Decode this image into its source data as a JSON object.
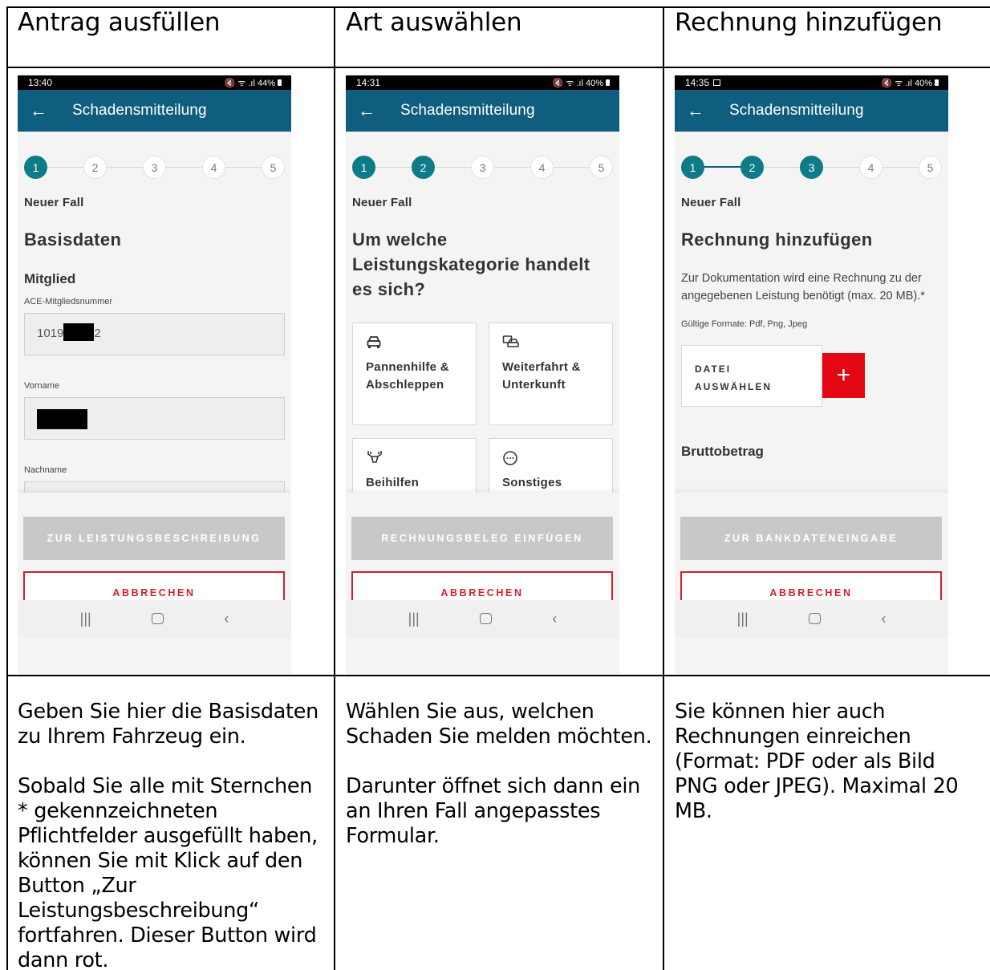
{
  "columns": [
    {
      "title": "Antrag ausfüllen",
      "description": [
        "Geben Sie hier die Basisdaten zu Ihrem Fahrzeug ein.",
        "Sobald Sie alle mit Sternchen * gekennzeichneten Pflichtfelder ausgefüllt haben, können Sie mit Klick auf den Button „Zur Leistungsbeschreibung“ fortfahren. Dieser Button wird dann rot."
      ],
      "phone": {
        "time": "13:40",
        "status_icons": "🔇 ᯤ .ıl 44%",
        "appbar_title": "Schadensmitteilung",
        "steps": [
          "1",
          "2",
          "3",
          "4",
          "5"
        ],
        "active_steps": 1,
        "case_label": "Neuer Fall",
        "heading": "Basisdaten",
        "section": "Mitglied",
        "fields": [
          {
            "label": "ACE-Mitgliedsnummer",
            "value_start": "1019",
            "value_end": "2"
          },
          {
            "label": "Vorname"
          },
          {
            "label": "Nachname"
          }
        ],
        "primary_button": "ZUR LEISTUNGSBESCHREIBUNG",
        "cancel_button": "ABBRECHEN"
      }
    },
    {
      "title": "Art auswählen",
      "description": [
        "Wählen Sie aus, welchen Schaden Sie melden möchten.",
        "Darunter öffnet sich dann ein an Ihren Fall angepasstes Formular."
      ],
      "phone": {
        "time": "14:31",
        "status_icons": "🔇 ᯤ .ıl 40%",
        "appbar_title": "Schadensmitteilung",
        "steps": [
          "1",
          "2",
          "3",
          "4",
          "5"
        ],
        "active_steps": 2,
        "case_label": "Neuer Fall",
        "heading": "Um welche Leistungskategorie handelt es sich?",
        "categories": [
          {
            "icon": "car-icon",
            "label": "Pannenhilfe & Abschleppen"
          },
          {
            "icon": "car-transfer-icon",
            "label": "Weiterfahrt & Unterkunft"
          },
          {
            "icon": "deer-icon",
            "label": "Beihilfen"
          },
          {
            "icon": "more-icon",
            "label": "Sonstiges"
          }
        ],
        "primary_button": "RECHNUNGSBELEG EINFÜGEN",
        "cancel_button": "ABBRECHEN"
      }
    },
    {
      "title": "Rechnung hinzufügen",
      "description": [
        "Sie können hier auch Rechnungen einreichen (Format: PDF oder als Bild PNG oder JPEG). Maximal 20 MB."
      ],
      "phone": {
        "time": "14:35",
        "status_icons": "🔇 ᯤ .ıl 40%",
        "appbar_title": "Schadensmitteilung",
        "steps": [
          "1",
          "2",
          "3",
          "4",
          "5"
        ],
        "active_steps": 3,
        "case_label": "Neuer Fall",
        "heading": "Rechnung hinzufügen",
        "info": "Zur Dokumentation wird eine Rechnung zu der angegebenen Leistung benötigt (max. 20 MB).*",
        "formats": "Gültige Formate: Pdf, Png, Jpeg",
        "pick_file": "DATEI AUSWÄHLEN",
        "plus": "+",
        "amount_label": "Bruttobetrag",
        "primary_button": "ZUR BANKDATENEINGABE",
        "cancel_button": "ABBRECHEN"
      }
    }
  ]
}
